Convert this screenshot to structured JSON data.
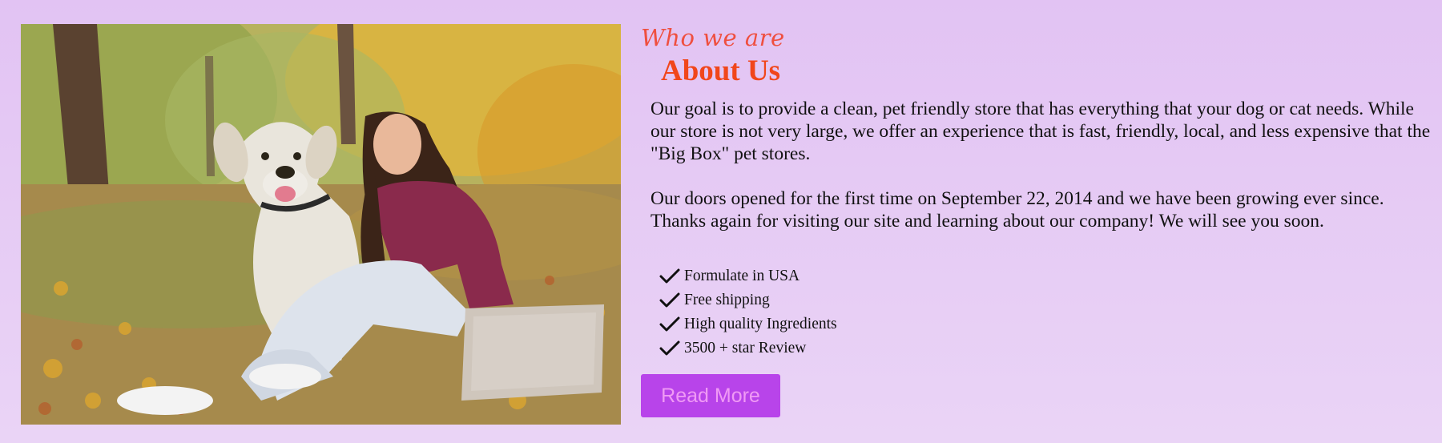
{
  "about": {
    "kicker": "Who we are",
    "heading": "About Us",
    "paragraphs": [
      "Our goal is to provide a clean, pet friendly store that has everything that your dog or cat needs. While our store is not very large, we offer an experience that is fast, friendly, local, and less expensive that the \"Big Box\" pet stores.",
      "Our doors opened for the first time on September 22, 2014 and we have been growing ever since. Thanks again for visiting our site and learning about our company! We will see you soon."
    ],
    "features": [
      "Formulate in USA",
      "Free shipping",
      "High quality Ingredients",
      "3500 + star Review"
    ],
    "button_label": "Read More",
    "icons": {
      "feature_bullet": "check-icon"
    },
    "colors": {
      "background": "#e2c3f3",
      "heading": "#f1461b",
      "kicker": "#ef4f3f",
      "button_bg": "#b844ea",
      "button_text": "#f09af5"
    }
  }
}
